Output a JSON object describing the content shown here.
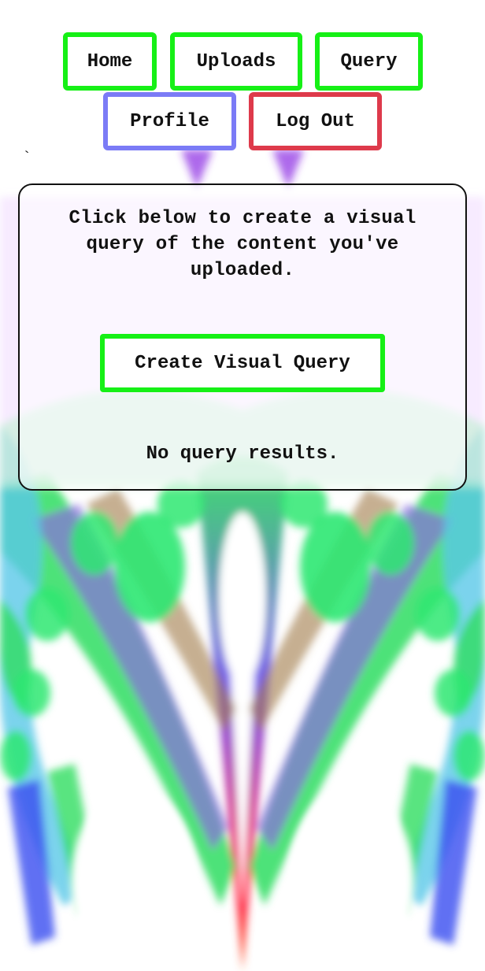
{
  "nav": {
    "home": "Home",
    "uploads": "Uploads",
    "query": "Query",
    "profile": "Profile",
    "logout": "Log Out"
  },
  "stray_mark": "`",
  "panel": {
    "intro": "Click below to create a visual query of the content you've uploaded.",
    "create_button": "Create Visual Query",
    "results_status": "No query results."
  },
  "colors": {
    "nav_green": "#16f016",
    "profile_border": "#7b7bf6",
    "logout_border": "#de3a4b"
  },
  "icons": {
    "background": "abstract-fractal-background"
  }
}
